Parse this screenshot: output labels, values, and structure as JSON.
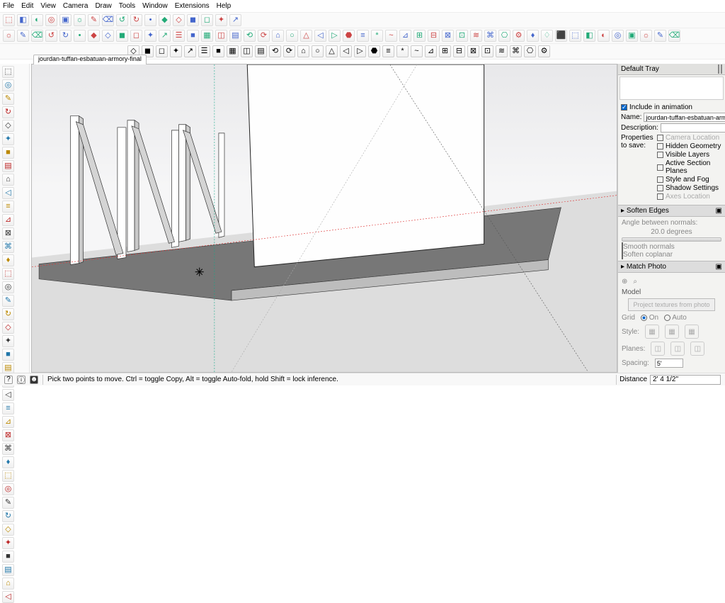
{
  "menu": [
    "File",
    "Edit",
    "View",
    "Camera",
    "Draw",
    "Tools",
    "Window",
    "Extensions",
    "Help"
  ],
  "tab": "jourdan-tuffan-esbatuan-armory-final",
  "tray": {
    "title": "Default Tray",
    "include": "Include in animation",
    "name_label": "Name:",
    "name_value": "jourdan-tuffan-esbatuan-arm",
    "desc_label": "Description:",
    "props_label": "Properties to save:",
    "props": [
      "Camera Location",
      "Hidden Geometry",
      "Visible Layers",
      "Active Section Planes",
      "Style and Fog",
      "Shadow Settings",
      "Axes Location"
    ],
    "soften": {
      "title": "Soften Edges",
      "angle_label": "Angle between normals:",
      "angle": "20.0",
      "degrees": "degrees",
      "sm": "Smooth normals",
      "sc": "Soften coplanar"
    },
    "match": {
      "title": "Match Photo",
      "model": "Model",
      "project": "Project textures from photo",
      "grid": "Grid",
      "on": "On",
      "auto": "Auto",
      "style": "Style:",
      "planes": "Planes:",
      "spacing": "Spacing:",
      "spacing_val": "5'"
    }
  },
  "status": {
    "hint": "Pick two points to move.  Ctrl = toggle Copy, Alt = toggle Auto-fold, hold Shift = lock inference.",
    "dist_label": "Distance",
    "dist_val": "2' 4 1/2\""
  },
  "toolbar_icons": [
    "⬚",
    "◧",
    "◐",
    "◎",
    "▣",
    "☼",
    "✎",
    "⌫",
    "↺",
    "↻",
    "•",
    "◆",
    "◇",
    "◼",
    "◻",
    "✦",
    "↗",
    "☰",
    "■",
    "▦",
    "◫",
    "▤",
    "⟲",
    "⟳",
    "⌂",
    "○",
    "△",
    "◁",
    "▷",
    "⬣",
    "≡",
    "*",
    "~",
    "⊿",
    "⊞",
    "⊟",
    "⊠",
    "⊡",
    "≋",
    "⌘",
    "⎔",
    "⚙",
    "♦",
    "♢",
    "⬛"
  ]
}
